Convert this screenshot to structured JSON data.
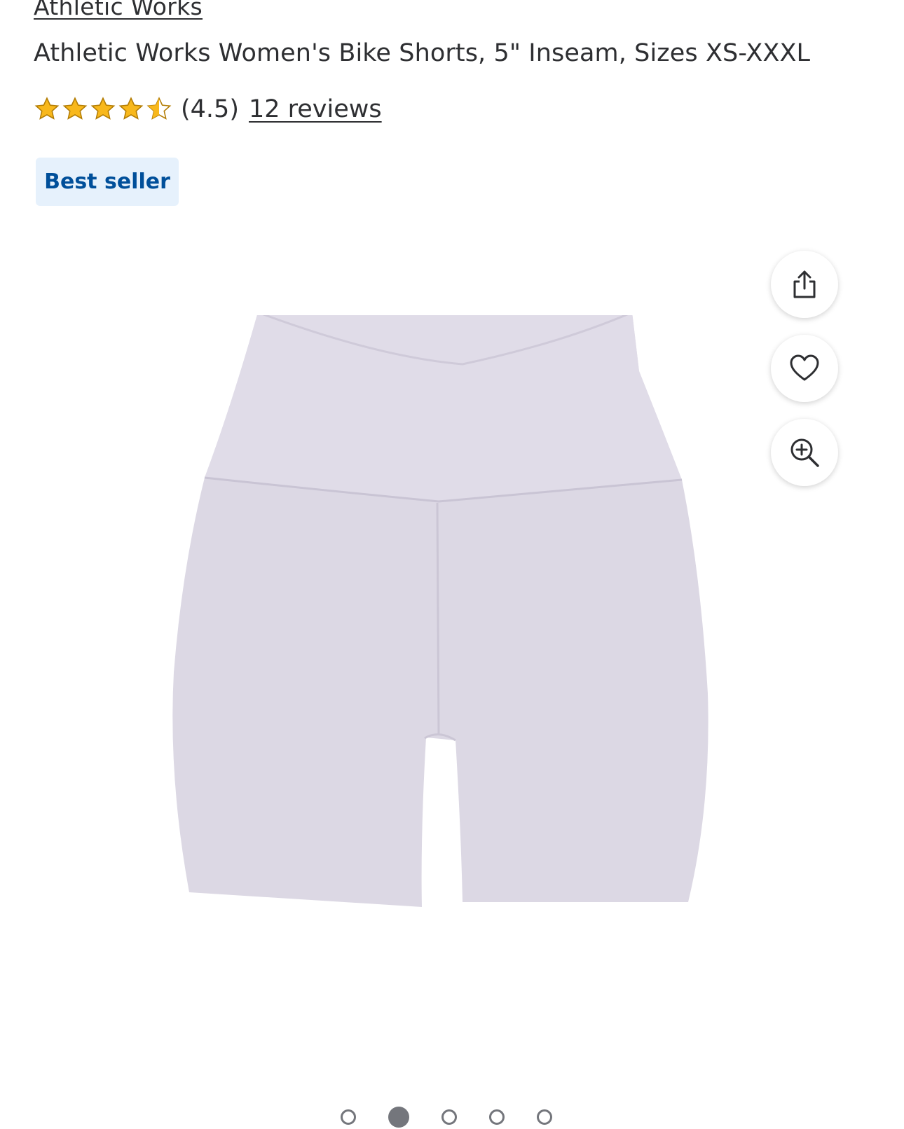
{
  "product": {
    "brand": "Athletic Works",
    "title": "Athletic Works Women's Bike Shorts, 5\" Inseam, Sizes XS-XXXL",
    "rating": {
      "value": 4.5,
      "display": "(4.5)",
      "reviews_label": "12 reviews"
    },
    "badge": "Best seller"
  },
  "image_actions": [
    {
      "name": "share",
      "icon": "share-icon"
    },
    {
      "name": "favorite",
      "icon": "heart-icon"
    },
    {
      "name": "zoom",
      "icon": "zoom-in-icon"
    }
  ],
  "carousel": {
    "total": 5,
    "active_index": 1
  },
  "colors": {
    "text": "#2e2f32",
    "badge_bg": "#e6f1fc",
    "badge_text": "#004f9a",
    "star": "#f8b81c",
    "star_outline": "#b37d05",
    "product": "#dcd8e4"
  }
}
